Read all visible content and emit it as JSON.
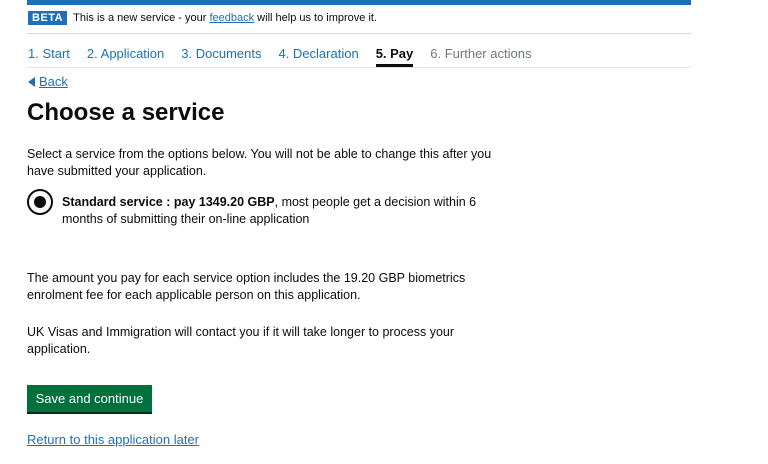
{
  "colors": {
    "brand_blue": "#1d70b8",
    "button_green": "#00703c",
    "text": "#0b0c0c"
  },
  "phase_banner": {
    "tag": "BETA",
    "text_before": "This is a new service - your ",
    "link": "feedback",
    "text_after": " will help us to improve it."
  },
  "steps": [
    {
      "label": "1. Start",
      "state": "link"
    },
    {
      "label": "2. Application",
      "state": "link"
    },
    {
      "label": "3. Documents",
      "state": "link"
    },
    {
      "label": "4. Declaration",
      "state": "link"
    },
    {
      "label": "5. Pay",
      "state": "current"
    },
    {
      "label": "6. Further actions",
      "state": "future"
    }
  ],
  "back": {
    "label": "Back",
    "icon": "left-triangle-icon"
  },
  "page_title": "Choose a service",
  "intro": "Select a service from the options below. You will not be able to change this after you have submitted your application.",
  "option": {
    "selected": true,
    "bold": "Standard service : pay 1349.20 GBP",
    "rest": ", most people get a decision within 6 months of submitting their on-line application"
  },
  "amount_text": "The amount you pay for each service option includes the 19.20 GBP biometrics enrolment fee for each applicable person on this application.",
  "contact_text": "UK Visas and Immigration will contact you if it will take longer to process your application.",
  "save_button": "Save and continue",
  "return_link": "Return to this application later"
}
